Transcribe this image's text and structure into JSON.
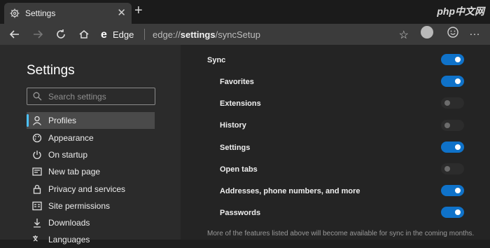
{
  "window": {
    "tab_title": "Settings",
    "watermark": "php中文网"
  },
  "toolbar": {
    "edge_label": "Edge",
    "url_prefix": "edge://",
    "url_bold": "settings",
    "url_suffix": "/syncSetup"
  },
  "sidebar": {
    "title": "Settings",
    "search_placeholder": "Search settings",
    "items": [
      {
        "label": "Profiles",
        "icon": "person-icon",
        "active": true
      },
      {
        "label": "Appearance",
        "icon": "palette-icon"
      },
      {
        "label": "On startup",
        "icon": "power-icon"
      },
      {
        "label": "New tab page",
        "icon": "newtab-icon"
      },
      {
        "label": "Privacy and services",
        "icon": "lock-icon"
      },
      {
        "label": "Site permissions",
        "icon": "permissions-icon"
      },
      {
        "label": "Downloads",
        "icon": "download-icon"
      },
      {
        "label": "Languages",
        "icon": "language-icon"
      }
    ]
  },
  "sync": {
    "rows": [
      {
        "label": "Sync",
        "on": true
      },
      {
        "label": "Favorites",
        "on": true
      },
      {
        "label": "Extensions",
        "on": false
      },
      {
        "label": "History",
        "on": false
      },
      {
        "label": "Settings",
        "on": true
      },
      {
        "label": "Open tabs",
        "on": false
      },
      {
        "label": "Addresses, phone numbers, and more",
        "on": true
      },
      {
        "label": "Passwords",
        "on": true
      }
    ],
    "footnote": "More of the features listed above will become available for sync in the coming months."
  },
  "colors": {
    "accent": "#0f72c9",
    "active_bar": "#4cc2ff"
  }
}
